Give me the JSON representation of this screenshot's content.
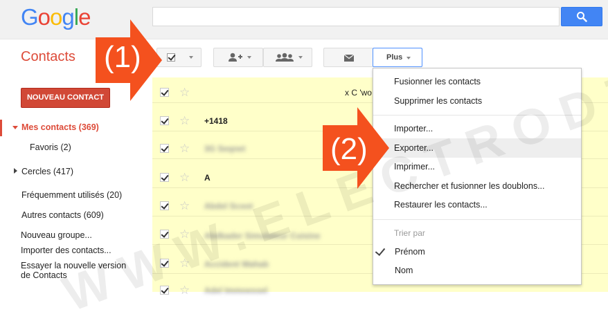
{
  "header": {
    "logo_letters": [
      {
        "ch": "G",
        "color": "#4285f4"
      },
      {
        "ch": "o",
        "color": "#ea4335"
      },
      {
        "ch": "o",
        "color": "#fbbc05"
      },
      {
        "ch": "g",
        "color": "#4285f4"
      },
      {
        "ch": "l",
        "color": "#34a853"
      },
      {
        "ch": "e",
        "color": "#ea4335"
      }
    ],
    "search_value": ""
  },
  "toolbar": {
    "app_title": "Contacts",
    "more_label": "Plus"
  },
  "sidebar": {
    "new_contact_label": "NOUVEAU CONTACT",
    "items": [
      {
        "label": "Mes contacts (369)"
      },
      {
        "label": "Favoris (2)"
      },
      {
        "label": "Cercles (417)"
      },
      {
        "label": "Fréquemment utilisés (20)"
      },
      {
        "label": "Autres contacts (609)"
      },
      {
        "label": "Nouveau groupe..."
      },
      {
        "label": "Importer des contacts..."
      },
      {
        "label": "Essayer la nouvelle version"
      },
      {
        "label": "de Contacts"
      }
    ]
  },
  "contacts": [
    {
      "name": "x C 'wo"
    },
    {
      "name": "+1418"
    },
    {
      "name": "3G Seqnet"
    },
    {
      "name": "A"
    },
    {
      "name": "Abdel Scoot"
    },
    {
      "name": "Abdkader Simulateur Cuisine"
    },
    {
      "name": "Accident Wahab"
    },
    {
      "name": "Adel Immoessel"
    }
  ],
  "menu": {
    "items": [
      {
        "label": "Fusionner les contacts"
      },
      {
        "label": "Supprimer les contacts"
      },
      {
        "label": "Importer..."
      },
      {
        "label": "Exporter..."
      },
      {
        "label": "Imprimer..."
      },
      {
        "label": "Rechercher et fusionner les doublons..."
      },
      {
        "label": "Restaurer les contacts..."
      }
    ],
    "sort_header": "Trier par",
    "sort_options": [
      {
        "label": "Prénom",
        "selected": true
      },
      {
        "label": "Nom",
        "selected": false
      }
    ]
  },
  "callouts": {
    "step1": "(1)",
    "step2": "(2)",
    "color": "#f4511e"
  },
  "watermark": "WWW.ELECTRODZ.COM"
}
